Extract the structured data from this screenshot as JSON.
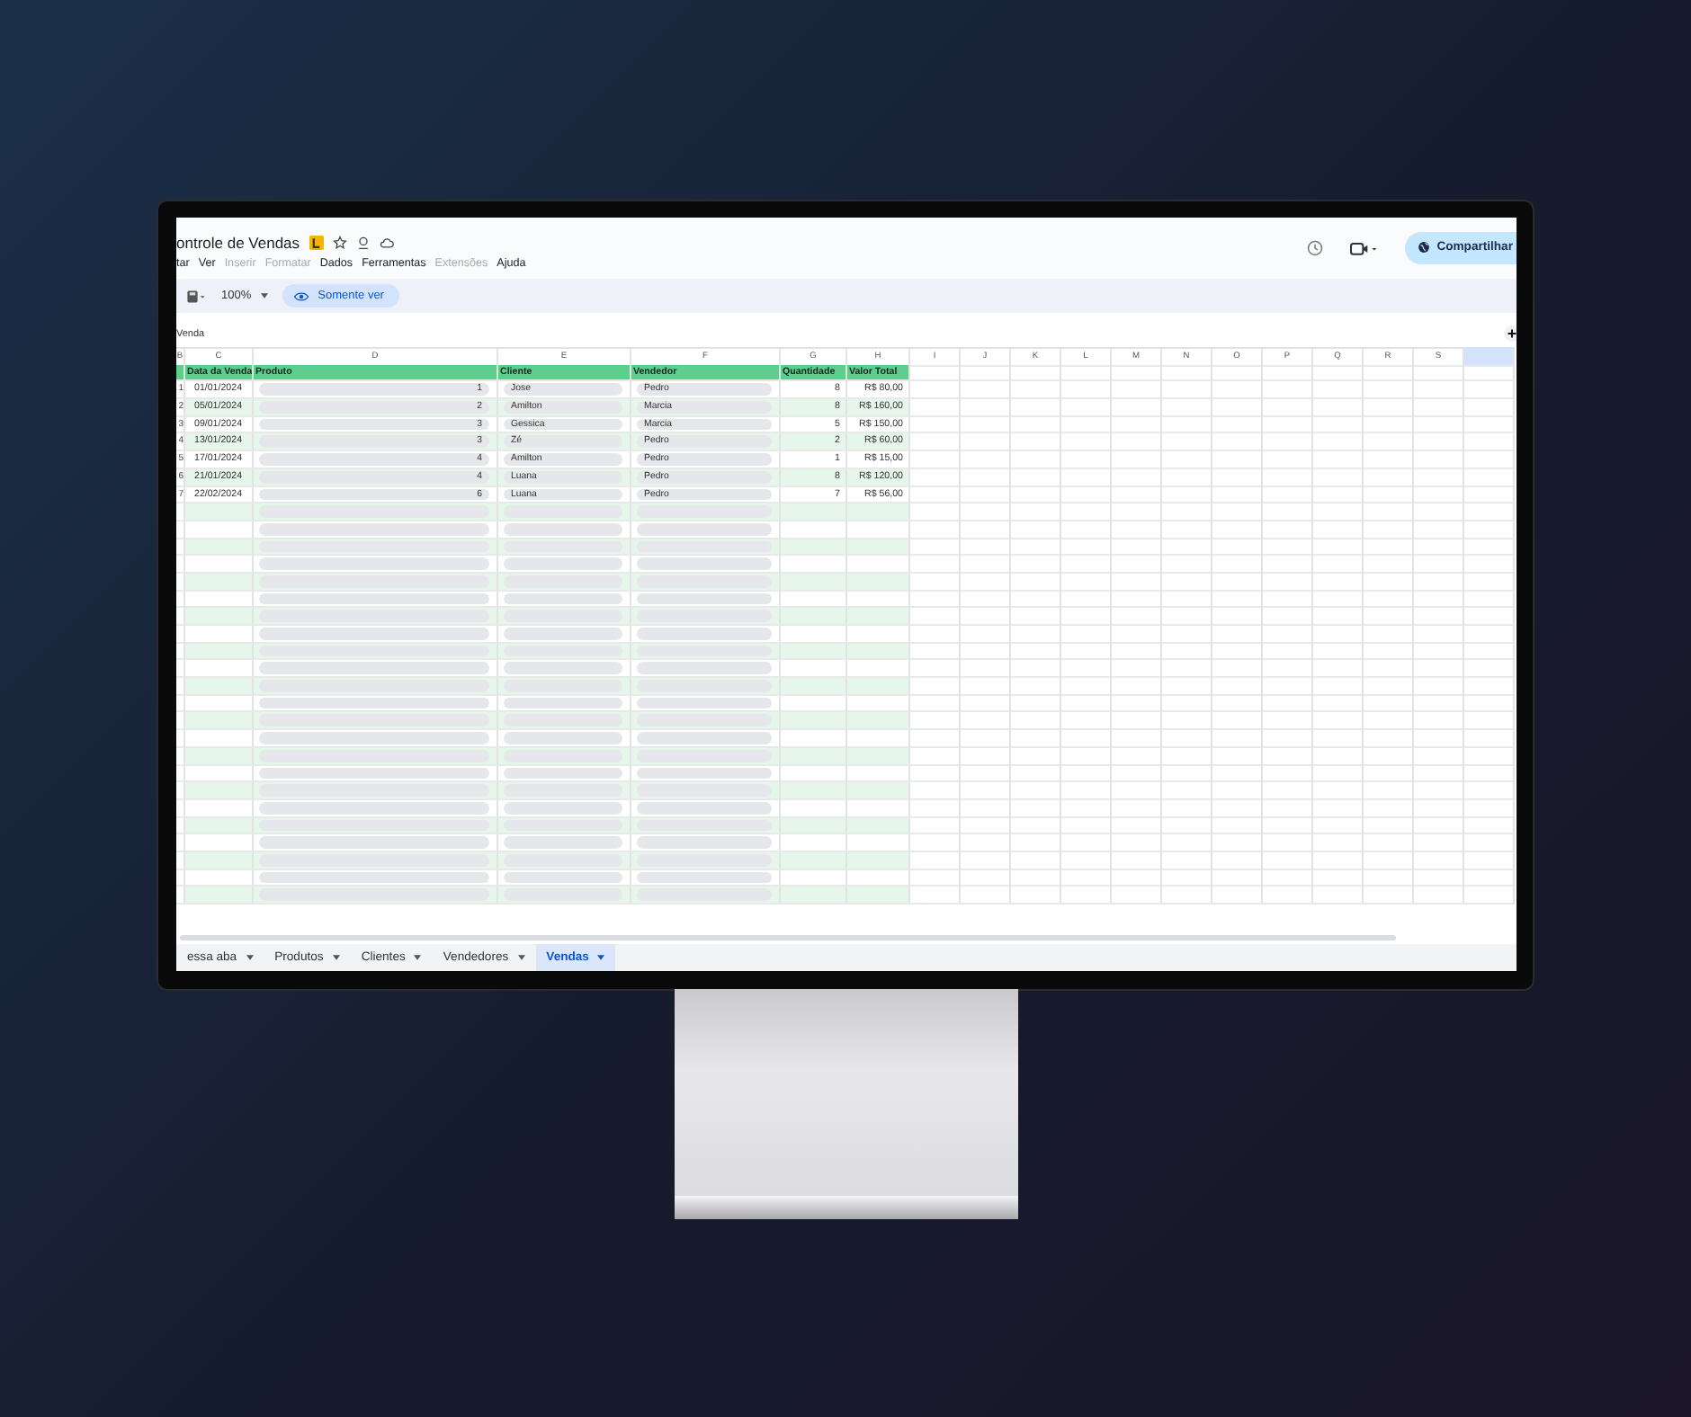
{
  "document": {
    "title": "ontrole de Vendas"
  },
  "menu": [
    {
      "label": "tar",
      "disabled": false
    },
    {
      "label": "Ver",
      "disabled": false
    },
    {
      "label": "Inserir",
      "disabled": true
    },
    {
      "label": "Formatar",
      "disabled": true
    },
    {
      "label": "Dados",
      "disabled": false
    },
    {
      "label": "Ferramentas",
      "disabled": false
    },
    {
      "label": "Extensões",
      "disabled": true
    },
    {
      "label": "Ajuda",
      "disabled": false
    }
  ],
  "toolbar": {
    "zoom": "100%",
    "mode_chip": "Somente ver"
  },
  "share_button": "Compartilhar",
  "formula_bar": {
    "cell_content": "Venda"
  },
  "grid": {
    "column_letters": [
      "B",
      "C",
      "D",
      "E",
      "F",
      "G",
      "H",
      "I",
      "J",
      "K",
      "L",
      "M",
      "N",
      "O",
      "P",
      "Q",
      "R",
      "S"
    ],
    "header": [
      "Data da Venda",
      "Produto",
      "Cliente",
      "Vendedor",
      "Quantidade",
      "Valor Total"
    ],
    "rows": [
      {
        "row_number": "1",
        "date": "01/01/2024",
        "product": "1",
        "client": "Jose",
        "seller": "Pedro",
        "quantity": "8",
        "total": "R$ 80,00"
      },
      {
        "row_number": "2",
        "date": "05/01/2024",
        "product": "2",
        "client": "Amilton",
        "seller": "Marcia",
        "quantity": "8",
        "total": "R$ 160,00"
      },
      {
        "row_number": "3",
        "date": "09/01/2024",
        "product": "3",
        "client": "Gessica",
        "seller": "Marcia",
        "quantity": "5",
        "total": "R$ 150,00"
      },
      {
        "row_number": "4",
        "date": "13/01/2024",
        "product": "3",
        "client": "Zé",
        "seller": "Pedro",
        "quantity": "2",
        "total": "R$ 60,00"
      },
      {
        "row_number": "5",
        "date": "17/01/2024",
        "product": "4",
        "client": "Amilton",
        "seller": "Pedro",
        "quantity": "1",
        "total": "R$ 15,00"
      },
      {
        "row_number": "6",
        "date": "21/01/2024",
        "product": "4",
        "client": "Luana",
        "seller": "Pedro",
        "quantity": "8",
        "total": "R$ 120,00"
      },
      {
        "row_number": "7",
        "date": "22/02/2024",
        "product": "6",
        "client": "Luana",
        "seller": "Pedro",
        "quantity": "7",
        "total": "R$ 56,00"
      }
    ]
  },
  "sheet_tabs": [
    {
      "label": "essa aba",
      "selected": false
    },
    {
      "label": "Produtos",
      "selected": false
    },
    {
      "label": "Clientes",
      "selected": false
    },
    {
      "label": "Vendedores",
      "selected": false
    },
    {
      "label": "Vendas",
      "selected": true
    }
  ]
}
